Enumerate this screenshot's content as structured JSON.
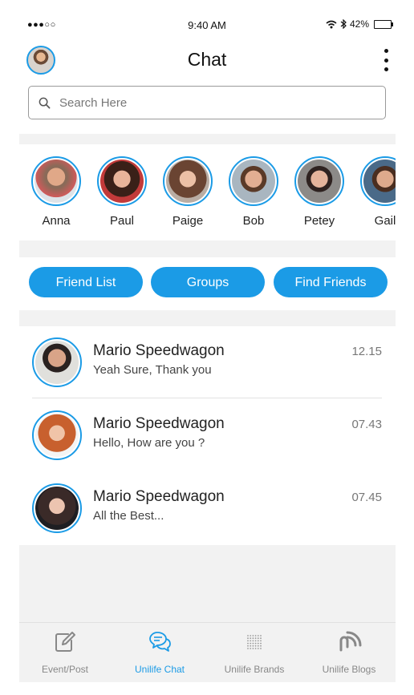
{
  "status_bar": {
    "signal": "●●●○○",
    "time": "9:40 AM",
    "battery": "42%",
    "battery_level": 0.42
  },
  "header": {
    "title": "Chat"
  },
  "search": {
    "placeholder": "Search Here"
  },
  "stories": [
    {
      "name": "Anna"
    },
    {
      "name": "Paul"
    },
    {
      "name": "Paige"
    },
    {
      "name": "Bob"
    },
    {
      "name": "Petey"
    },
    {
      "name": "Gail"
    }
  ],
  "tabs": [
    "Friend List",
    "Groups",
    "Find Friends"
  ],
  "chats": [
    {
      "name": "Mario Speedwagon",
      "message": "Yeah Sure, Thank you",
      "time": "12.15"
    },
    {
      "name": "Mario Speedwagon",
      "message": "Hello, How are you ?",
      "time": "07.43"
    },
    {
      "name": "Mario Speedwagon",
      "message": "All the Best...",
      "time": "07.45"
    }
  ],
  "bottom_nav": [
    {
      "label": "Event/Post",
      "icon": "edit-icon"
    },
    {
      "label": "Unilife Chat",
      "icon": "chat-bubbles-icon",
      "active": true
    },
    {
      "label": "Unilife Brands",
      "icon": "dots-grid-icon"
    },
    {
      "label": "Unilife Blogs",
      "icon": "rss-icon"
    }
  ],
  "colors": {
    "accent": "#1b9be6",
    "background": "#f2f2f2"
  }
}
